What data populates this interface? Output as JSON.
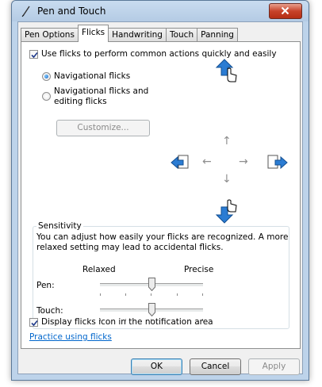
{
  "window": {
    "title": "Pen and Touch"
  },
  "tabs": [
    {
      "label": "Pen Options"
    },
    {
      "label": "Flicks"
    },
    {
      "label": "Handwriting"
    },
    {
      "label": "Touch"
    },
    {
      "label": "Panning"
    }
  ],
  "flicks": {
    "use_flicks_label": "Use flicks to perform common actions quickly and easily",
    "use_flicks_checked": true,
    "radio_navigational": "Navigational flicks",
    "radio_editing_line1": "Navigational flicks and",
    "radio_editing_line2": "editing flicks",
    "selected_mode": "Navigational flicks",
    "customize_button": "Customize..."
  },
  "sensitivity": {
    "group_title": "Sensitivity",
    "description_line1": "You can adjust how easily your flicks are recognized. A more",
    "description_line2": "relaxed setting may lead to accidental flicks.",
    "relaxed_label": "Relaxed",
    "precise_label": "Precise",
    "pen_label": "Pen:",
    "touch_label": "Touch:",
    "pen_level": 0.5,
    "touch_level": 0.5
  },
  "footer": {
    "display_icon_label": "Display flicks icon in the notification area",
    "display_icon_checked": true,
    "practice_link": "Practice using flicks"
  },
  "buttons": {
    "ok": "OK",
    "cancel": "Cancel",
    "apply": "Apply"
  }
}
